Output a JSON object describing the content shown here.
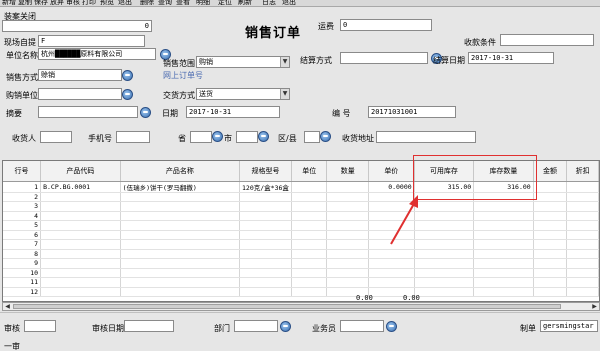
{
  "toolbar": {
    "items": [
      "新增",
      "复制",
      "保存",
      "放弃",
      "审核",
      "打印",
      "预览",
      "退出",
      "删除",
      "查询",
      "查看",
      "明细",
      "定位",
      "刷新",
      "日志",
      "退出"
    ]
  },
  "form": {
    "title": "销售订单",
    "closed_label": "装案关闭",
    "closed_value": "0",
    "spot_label": "现场自提",
    "spot_value": "F",
    "freight_label": "运费",
    "freight_value": "0",
    "collect_label": "收款条件",
    "collect_value": "",
    "unit_label": "单位名称",
    "unit_value": "杭州██████原料有限公司",
    "sales_range_label": "销售范围",
    "sales_range_value": "购销",
    "settle_method_label": "结算方式",
    "settle_method_value": "",
    "settle_date_label": "结算日期",
    "settle_date_value": "2017-10-31",
    "sales_method_label": "销售方式",
    "sales_method_value": "赊销",
    "online_order_label": "网上订单号",
    "online_order_value": "",
    "buyer_label": "购销单位",
    "buyer_value": "",
    "delivery_label": "交货方式",
    "delivery_value": "送货",
    "summary_label": "摘要",
    "summary_value": "",
    "date_label": "日期",
    "date_value": "2017-10-31",
    "number_label": "编    号",
    "number_value": "20171031001",
    "receiver_label": "收货人",
    "receiver_value": "",
    "phone_label": "手机号",
    "phone_value": "",
    "province_label": "省",
    "province_value": "",
    "city_label": "市",
    "city_value": "",
    "district_label": "区/县",
    "district_value": "",
    "address_label": "收货地址",
    "address_value": ""
  },
  "grid": {
    "columns": [
      "行号",
      "产品代码",
      "产品名称",
      "规格型号",
      "单位",
      "数量",
      "单价",
      "可用库存",
      "库存数量",
      "金额",
      "折扣"
    ],
    "rows": [
      {
        "no": "1",
        "code": "B.CP.BG.0001",
        "name": "(伍瑞乡)饼干(罗马翻撒)",
        "spec": "120克/盒*36盒",
        "unit": "",
        "qty": "",
        "price": "0.0000",
        "avail": "315.00",
        "stock": "316.00",
        "amount": "",
        "disc": ""
      },
      {
        "no": "2"
      },
      {
        "no": "3"
      },
      {
        "no": "4"
      },
      {
        "no": "5"
      },
      {
        "no": "6"
      },
      {
        "no": "7"
      },
      {
        "no": "8"
      },
      {
        "no": "9"
      },
      {
        "no": "10"
      },
      {
        "no": "11"
      },
      {
        "no": "12"
      }
    ],
    "total_qty": "0.00",
    "total_price": "0.00"
  },
  "footer": {
    "audit_label": "审核",
    "audit_value": "",
    "audit_date_label": "审核日期",
    "audit_date_value": "",
    "dept_label": "部门",
    "dept_value": "",
    "salesman_label": "业务员",
    "salesman_value": "",
    "maker_label": "制单",
    "maker_value": "gersmingstar",
    "first_audit_label": "一审"
  },
  "colors": {
    "highlight": "#e03030"
  }
}
